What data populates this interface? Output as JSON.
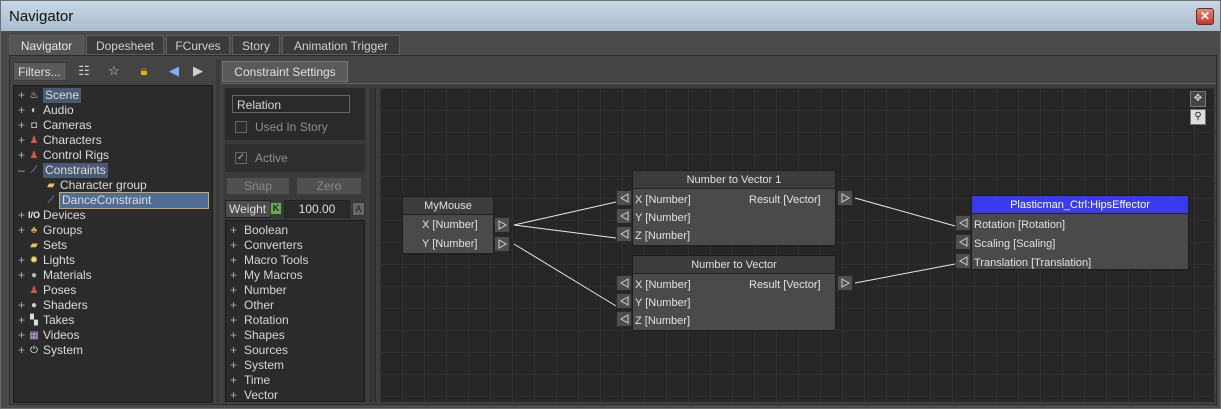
{
  "window": {
    "title": "Navigator",
    "close_glyph": "✕"
  },
  "tabs": [
    {
      "label": "Navigator",
      "active": true
    },
    {
      "label": "Dopesheet"
    },
    {
      "label": "FCurves"
    },
    {
      "label": "Story"
    },
    {
      "label": "Animation Trigger"
    }
  ],
  "left": {
    "filters_label": "Filters...",
    "toolbar_icons": [
      "list-view-icon",
      "star-pointer-icon",
      "lock-icon",
      "back-arrow-icon",
      "forward-arrow-icon"
    ],
    "tree": [
      {
        "label": "Scene",
        "icon": "teapot-icon",
        "expander": "+"
      },
      {
        "label": "Audio",
        "icon": "speaker-icon",
        "expander": "+"
      },
      {
        "label": "Cameras",
        "icon": "camera-icon",
        "expander": "+"
      },
      {
        "label": "Characters",
        "icon": "character-icon",
        "expander": "+"
      },
      {
        "label": "Control Rigs",
        "icon": "control-rig-icon",
        "expander": "+"
      },
      {
        "label": "Constraints",
        "icon": "constraint-icon",
        "expander": "–"
      },
      {
        "label": "Character group",
        "icon": "folder-icon",
        "expander": ""
      },
      {
        "label": "DanceConstraint",
        "icon": "constraint-icon",
        "expander": ""
      },
      {
        "label": "Devices",
        "icon": "io-icon",
        "expander": "+",
        "icon_text": "I/O"
      },
      {
        "label": "Groups",
        "icon": "groups-icon",
        "expander": "+"
      },
      {
        "label": "Sets",
        "icon": "sets-icon",
        "expander": ""
      },
      {
        "label": "Lights",
        "icon": "light-icon",
        "expander": "+"
      },
      {
        "label": "Materials",
        "icon": "material-icon",
        "expander": "+"
      },
      {
        "label": "Poses",
        "icon": "pose-icon",
        "expander": ""
      },
      {
        "label": "Shaders",
        "icon": "shader-icon",
        "expander": "+"
      },
      {
        "label": "Takes",
        "icon": "clapper-icon",
        "expander": "+"
      },
      {
        "label": "Videos",
        "icon": "video-icon",
        "expander": "+"
      },
      {
        "label": "System",
        "icon": "system-icon",
        "expander": "+"
      }
    ]
  },
  "constraint_settings": {
    "tab_label": "Constraint Settings",
    "relation_label": "Relation",
    "used_in_story_label": "Used In Story",
    "active_label": "Active",
    "snap_label": "Snap",
    "zero_label": "Zero",
    "weight_label": "Weight",
    "weight_key": "K",
    "weight_value": "100.00",
    "weight_anim": "A",
    "operators": [
      "Boolean",
      "Converters",
      "Macro Tools",
      "My Macros",
      "Number",
      "Other",
      "Rotation",
      "Shapes",
      "Sources",
      "System",
      "Time",
      "Vector"
    ]
  },
  "graph": {
    "nodes": {
      "mymouse": {
        "title": "MyMouse",
        "outputs": [
          "X [Number]",
          "Y [Number]"
        ]
      },
      "ntv1": {
        "title": "Number to Vector 1",
        "inputs": [
          "X [Number]",
          "Y [Number]",
          "Z [Number]"
        ],
        "output": "Result [Vector]"
      },
      "ntv": {
        "title": "Number to Vector",
        "inputs": [
          "X [Number]",
          "Y [Number]",
          "Z [Number]"
        ],
        "output": "Result [Vector]"
      },
      "hips": {
        "title": "Plasticman_Ctrl:HipsEffector",
        "inputs": [
          "Rotation [Rotation]",
          "Scaling [Scaling]",
          "Translation [Translation]"
        ]
      }
    },
    "header_color": "#3a3aee",
    "corner_icons": [
      "move-view-icon",
      "zoom-icon"
    ]
  }
}
